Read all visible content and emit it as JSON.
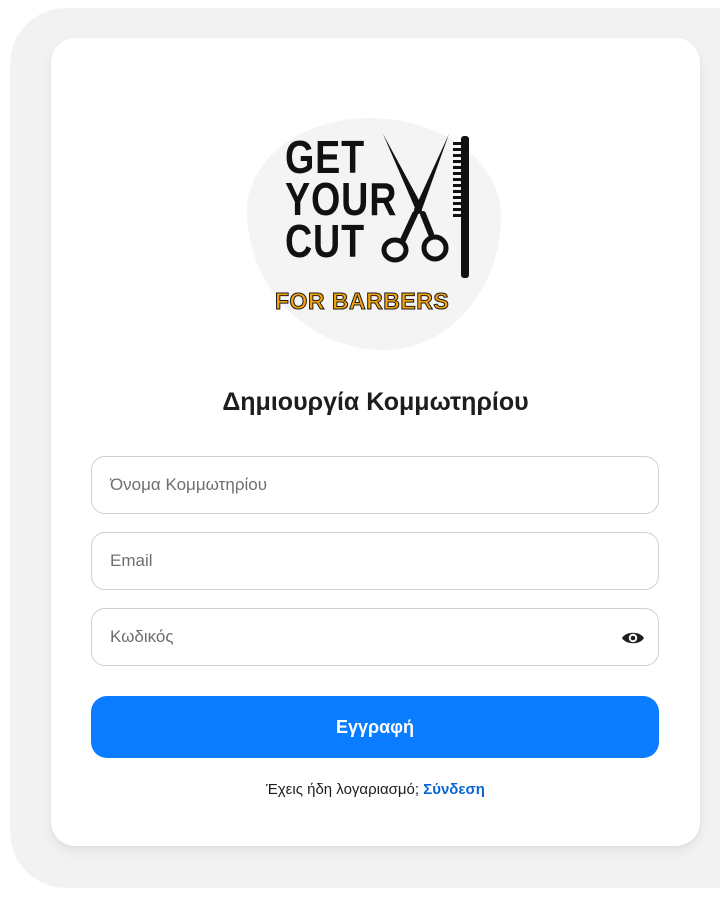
{
  "logo": {
    "line1": "GET",
    "line2": "YOUR",
    "line3": "CUT",
    "subtitle": "FOR BARBERS",
    "icon": "scissors-comb-icon",
    "accent_color": "#f5a50b"
  },
  "form": {
    "title": "Δημιουργία Κομμωτηρίου",
    "fields": {
      "salon_name": {
        "placeholder": "Όνομα Κομμωτηρίου",
        "value": ""
      },
      "email": {
        "placeholder": "Email",
        "value": ""
      },
      "password": {
        "placeholder": "Κωδικός",
        "value": "",
        "toggle_icon": "eye-icon"
      }
    },
    "submit_label": "Εγγραφή",
    "login_prompt": "Έχεις ήδη λογαριασμό;",
    "login_link": "Σύνδεση"
  },
  "colors": {
    "primary": "#0a7cff",
    "link": "#0a66d6",
    "frame": "#f2f2f2"
  }
}
